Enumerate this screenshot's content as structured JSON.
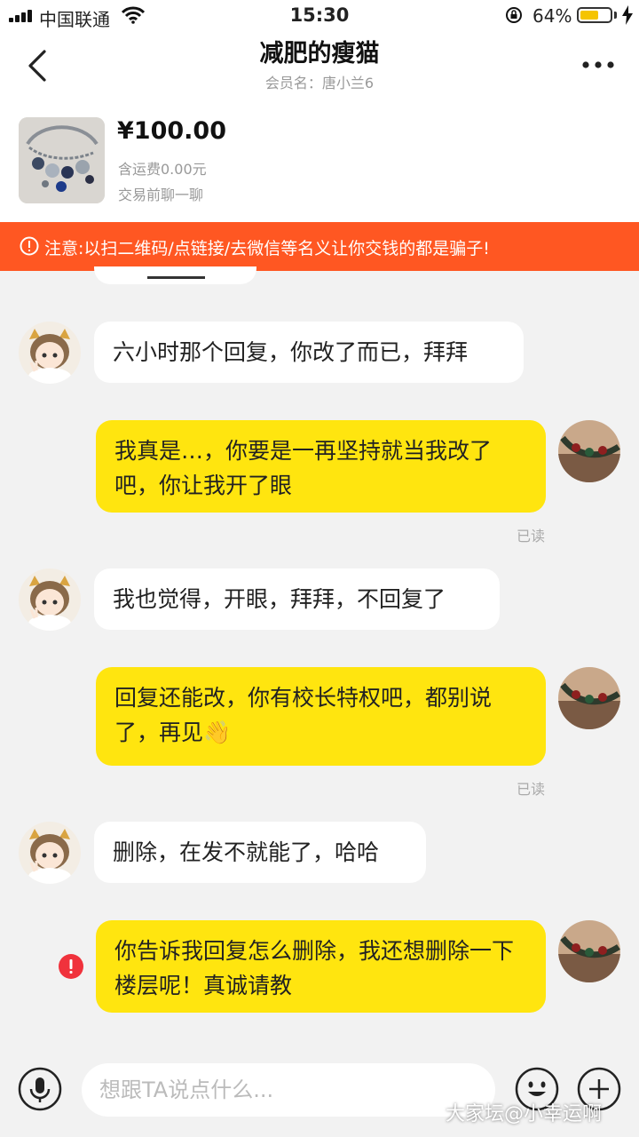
{
  "status_bar": {
    "carrier": "中国联通",
    "time": "15:30",
    "battery_percent": "64%",
    "battery_level": 0.64,
    "icons": [
      "signal-icon",
      "wifi-icon",
      "orientation-lock-icon",
      "battery-icon",
      "charging-icon"
    ]
  },
  "header": {
    "title": "减肥的瘦猫",
    "subtitle": "会员名：唐小兰6",
    "icons": [
      "back-arrow-icon",
      "more-icon"
    ]
  },
  "product": {
    "price": "¥100.00",
    "shipping": "含运费0.00元",
    "note": "交易前聊一聊"
  },
  "warning": {
    "text": "注意:以扫二维码/点链接/去微信等名义让你交钱的都是骗子!",
    "icon": "warning-icon",
    "color": "#ff5722"
  },
  "messages": [
    {
      "side": "in",
      "text": "六小时那个回复，你改了而已，拜拜"
    },
    {
      "side": "out",
      "text": "我真是…，你要是一再坚持就当我改了吧，你让我开了眼",
      "status": "已读"
    },
    {
      "side": "in",
      "text": "我也觉得，开眼，拜拜，不回复了"
    },
    {
      "side": "out",
      "text": "回复还能改，你有校长特权吧，都别说了，再见👋",
      "status": "已读"
    },
    {
      "side": "in",
      "text": "删除，在发不就能了，哈哈"
    },
    {
      "side": "out",
      "text": "你告诉我回复怎么删除，我还想删除一下楼层呢！真诚请教",
      "failed": true
    }
  ],
  "input_bar": {
    "placeholder": "想跟TA说点什么...",
    "icons": [
      "microphone-icon",
      "emoji-icon",
      "plus-icon"
    ]
  },
  "watermark": "大家坛@小幸运啊",
  "colors": {
    "accent_yellow": "#ffe50f",
    "warning_orange": "#ff5722",
    "background": "#f2f2f2",
    "failed_red": "#f0323c"
  }
}
